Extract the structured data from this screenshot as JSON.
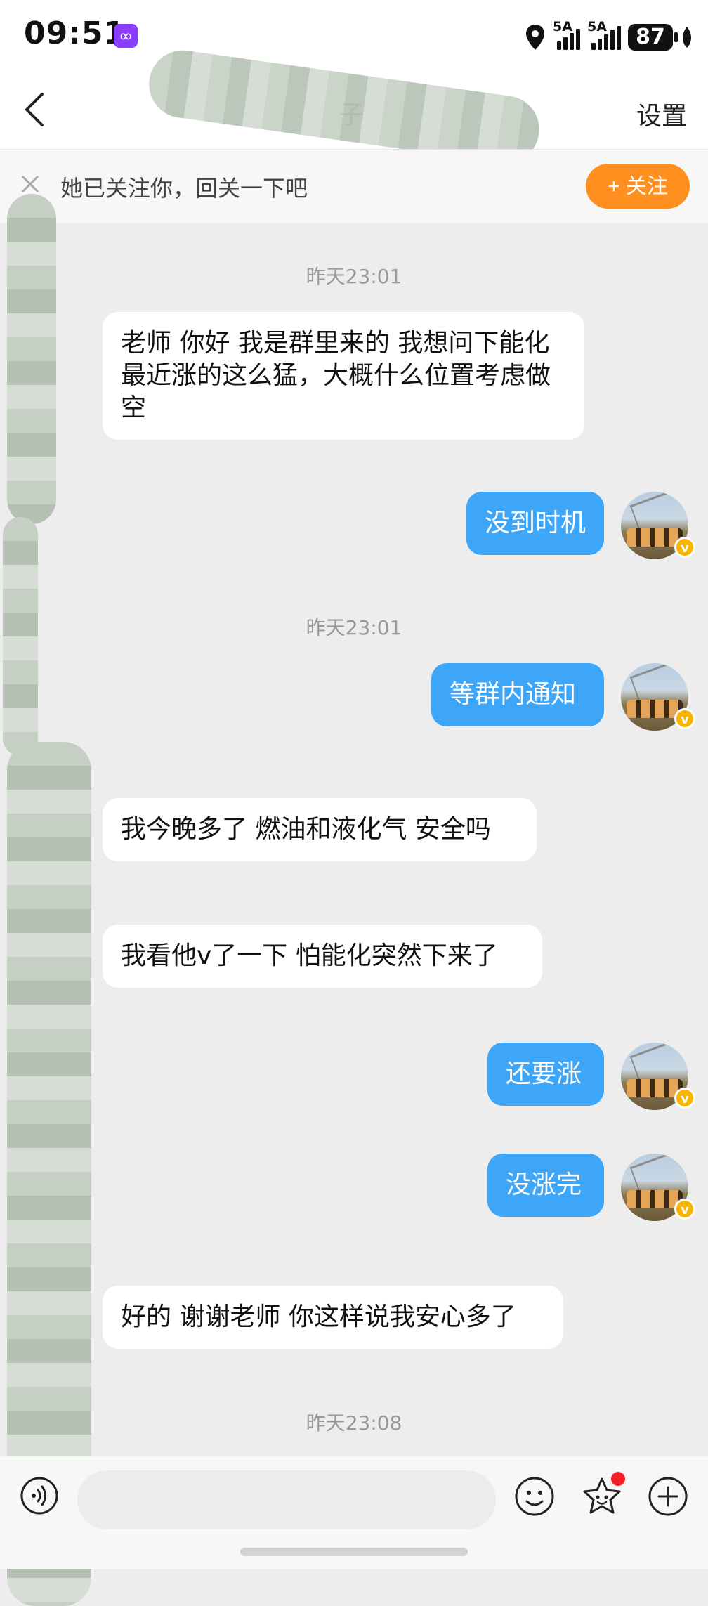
{
  "status_bar": {
    "time": "09:51",
    "network1": "5A",
    "network2": "5A",
    "battery": "87"
  },
  "header": {
    "title_visible": "子",
    "settings_label": "设置"
  },
  "follow_banner": {
    "text": "她已关注你，回关一下吧",
    "button_label": "+ 关注"
  },
  "messages": [
    {
      "type": "timestamp",
      "text": "昨天23:01"
    },
    {
      "type": "incoming",
      "text": "老师 你好 我是群里来的 我想问下能化最近涨的这么猛，大概什么位置考虑做空"
    },
    {
      "type": "outgoing",
      "text": "没到时机"
    },
    {
      "type": "timestamp",
      "text": "昨天23:01"
    },
    {
      "type": "outgoing",
      "text": "等群内通知"
    },
    {
      "type": "incoming",
      "text": "我今晚多了 燃油和液化气 安全吗"
    },
    {
      "type": "incoming",
      "text": "我看他v了一下 怕能化突然下来了"
    },
    {
      "type": "outgoing",
      "text": "还要涨"
    },
    {
      "type": "outgoing",
      "text": "没涨完"
    },
    {
      "type": "incoming",
      "text": "好的 谢谢老师 你这样说我安心多了"
    },
    {
      "type": "timestamp",
      "text": "昨天23:08"
    }
  ],
  "avatar_badge": "v",
  "composer": {
    "placeholder": "",
    "icons": [
      "voice-icon",
      "emoji-icon",
      "sticker-star-icon",
      "plus-icon"
    ]
  },
  "colors": {
    "outgoing_bubble": "#3ea6f8",
    "follow_button": "#ff8f1f",
    "badge": "#f7b500"
  }
}
